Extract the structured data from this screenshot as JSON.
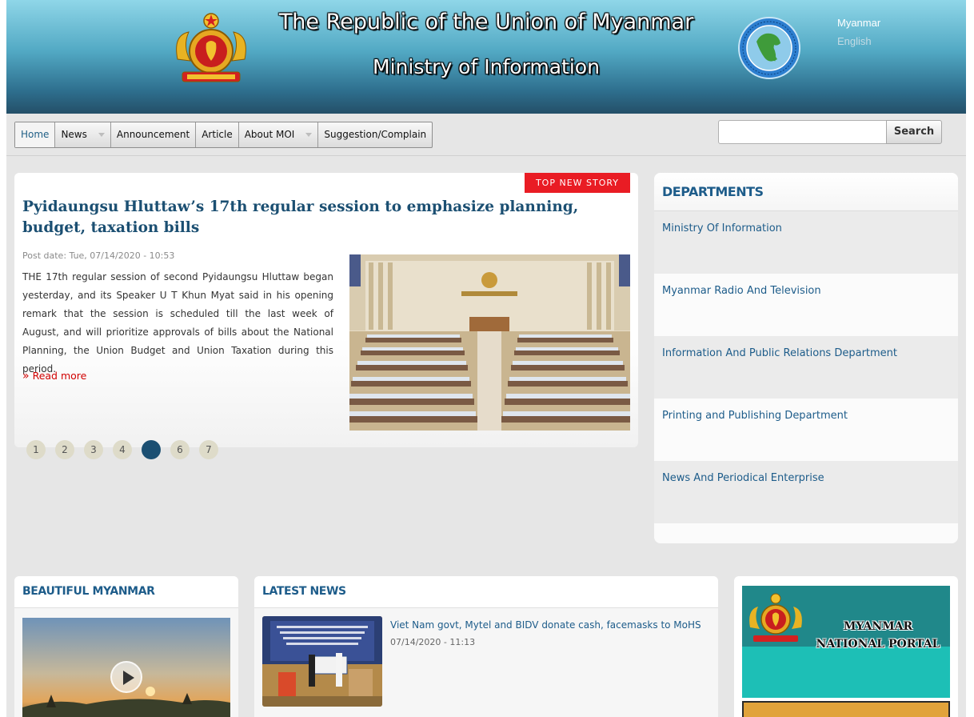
{
  "header": {
    "title": "The Republic of the Union of Myanmar",
    "subtitle": "Ministry of Information",
    "languages": [
      "Myanmar",
      "English"
    ],
    "colors": {
      "header_top": "#8fd6e8",
      "header_bottom": "#244f68",
      "title_text": "#ffffff"
    }
  },
  "nav": {
    "items": [
      {
        "label": "Home",
        "dropdown": false,
        "active": true
      },
      {
        "label": "News",
        "dropdown": true
      },
      {
        "label": "Announcement",
        "dropdown": false
      },
      {
        "label": "Article",
        "dropdown": false
      },
      {
        "label": "About MOI",
        "dropdown": true
      },
      {
        "label": "Suggestion/Complain",
        "dropdown": false
      }
    ],
    "search": {
      "placeholder": "",
      "button_label": "Search"
    }
  },
  "top_story": {
    "badge": "TOP NEW STORY",
    "title": "Pyidaungsu Hluttaw’s 17th regular session to emphasize planning, budget, taxation bills",
    "post_date": "Post date: Tue, 07/14/2020 - 10:53",
    "body": "THE 17th regular session of second Pyidaungsu Hluttaw began yesterday, and its Speaker U T Khun Myat said in his opening remark that the session is scheduled till the last week of August, and will prioritize approvals of bills about the National Planning, the Union Budget and Union Taxation during this period.",
    "read_more": "Read more",
    "pager": [
      "1",
      "2",
      "3",
      "4",
      "5",
      "6",
      "7"
    ],
    "pager_active": "5",
    "colors": {
      "badge": "#e91c24",
      "title": "#1b4f72",
      "read_more": "#d10000"
    }
  },
  "departments": {
    "heading": "DEPARTMENTS",
    "items": [
      "Ministry Of Information",
      "Myanmar Radio And Television",
      "Information And Public Relations Department",
      "Printing and Publishing Department",
      "News And Periodical Enterprise"
    ]
  },
  "beautiful_myanmar": {
    "heading": "BEAUTIFUL MYANMAR"
  },
  "latest_news": {
    "heading": "LATEST NEWS",
    "items": [
      {
        "title": "Viet Nam govt, Mytel and BIDV donate cash, facemasks to MoHS",
        "date": "07/14/2020 - 11:13"
      }
    ]
  },
  "portal": {
    "text": "MYANMAR NATIONAL PORTAL"
  }
}
